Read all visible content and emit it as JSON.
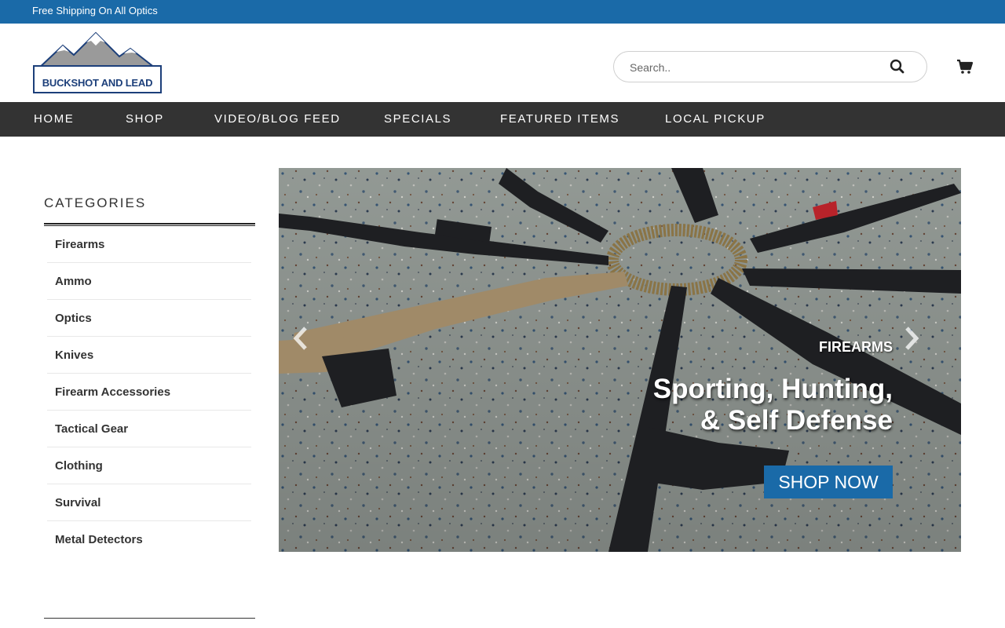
{
  "topbar": {
    "announcement": "Free Shipping On All Optics"
  },
  "header": {
    "logo_text": "BUCKSHOT AND LEAD",
    "search_placeholder": "Search..",
    "colors": {
      "topbar": "#1a6aa8",
      "nav": "#333333",
      "accent": "#1a6aa8"
    }
  },
  "nav": {
    "items": [
      {
        "label": "HOME"
      },
      {
        "label": "SHOP"
      },
      {
        "label": "VIDEO/BLOG FEED"
      },
      {
        "label": "SPECIALS"
      },
      {
        "label": "FEATURED ITEMS"
      },
      {
        "label": "LOCAL PICKUP"
      }
    ]
  },
  "sidebar": {
    "title": "CATEGORIES",
    "items": [
      {
        "label": "Firearms"
      },
      {
        "label": "Ammo"
      },
      {
        "label": "Optics"
      },
      {
        "label": "Knives"
      },
      {
        "label": "Firearm Accessories"
      },
      {
        "label": "Tactical Gear"
      },
      {
        "label": "Clothing"
      },
      {
        "label": "Survival"
      },
      {
        "label": "Metal Detectors"
      }
    ]
  },
  "hero": {
    "eyebrow": "FIREARMS",
    "title_line1": "Sporting, Hunting,",
    "title_line2": "& Self Defense",
    "cta": "SHOP NOW",
    "icons": {
      "prev": "chevron-left-icon",
      "next": "chevron-right-icon"
    }
  }
}
